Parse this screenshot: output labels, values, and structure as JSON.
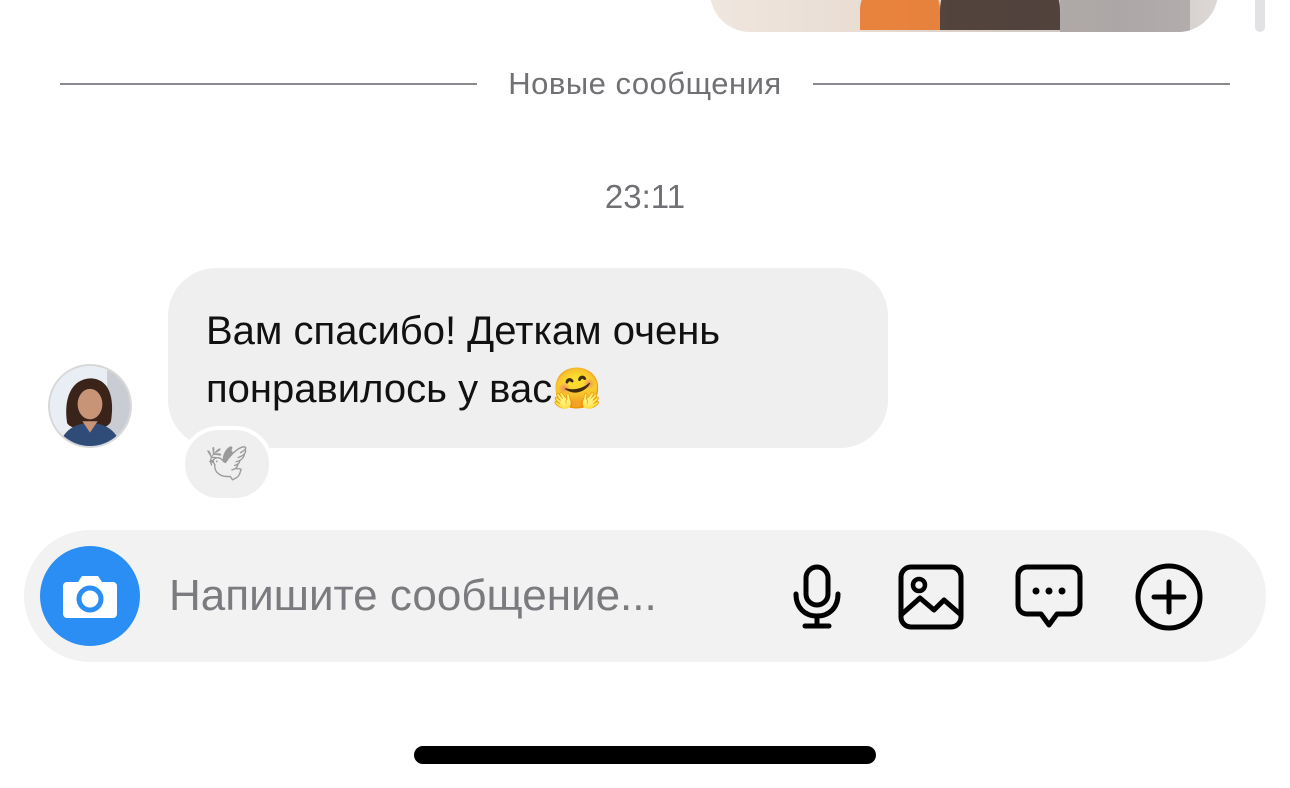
{
  "divider": {
    "label": "Новые сообщения"
  },
  "thread": {
    "timestamp": "23:11",
    "message": {
      "line1": "Вам спасибо! Деткам очень",
      "line2": "понравилось у вас",
      "emoji": "🤗",
      "reaction": "🕊"
    }
  },
  "composer": {
    "placeholder": "Напишите сообщение...",
    "accent": "#2a8ef4"
  },
  "icons": [
    "camera-icon",
    "microphone-icon",
    "gallery-icon",
    "chat-bubble-icon",
    "plus-icon"
  ]
}
